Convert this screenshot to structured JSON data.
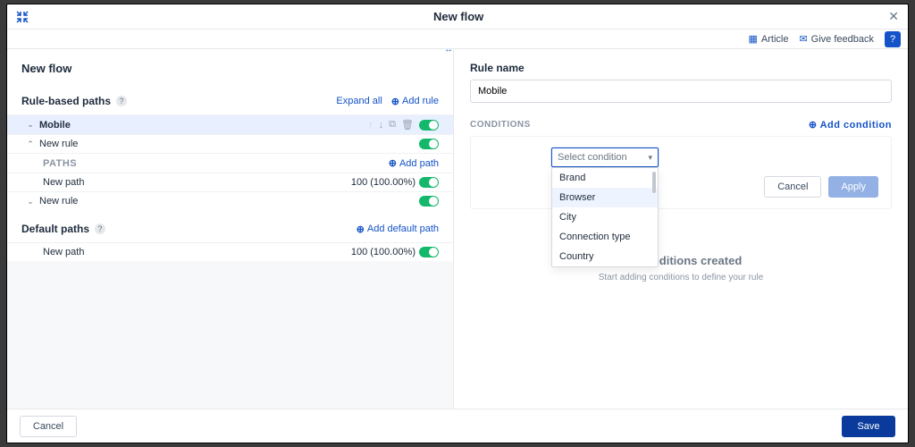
{
  "titlebar": {
    "title": "New flow"
  },
  "toolbar": {
    "article": "Article",
    "feedback": "Give feedback"
  },
  "left": {
    "title": "New flow",
    "rule_based": {
      "heading": "Rule-based paths",
      "expand_all": "Expand all",
      "add_rule": "Add rule"
    },
    "rows": {
      "mobile": "Mobile",
      "new_rule_1": "New rule",
      "paths_label": "PATHS",
      "add_path": "Add path",
      "new_path_1": "New path",
      "new_path_1_pct": "100 (100.00%)",
      "new_rule_2": "New rule"
    },
    "default": {
      "heading": "Default paths",
      "add_default_path": "Add default path",
      "new_path": "New path",
      "new_path_pct": "100 (100.00%)"
    }
  },
  "right": {
    "rule_name_label": "Rule name",
    "rule_name_value": "Mobile",
    "conditions_label": "CONDITIONS",
    "add_condition": "Add condition",
    "select_placeholder": "Select condition",
    "options": {
      "o0": "Brand",
      "o1": "Browser",
      "o2": "City",
      "o3": "Connection type",
      "o4": "Country"
    },
    "cancel": "Cancel",
    "apply": "Apply",
    "empty_title": "No conditions created",
    "empty_sub": "Start adding conditions to define your rule"
  },
  "footer": {
    "cancel": "Cancel",
    "save": "Save"
  }
}
